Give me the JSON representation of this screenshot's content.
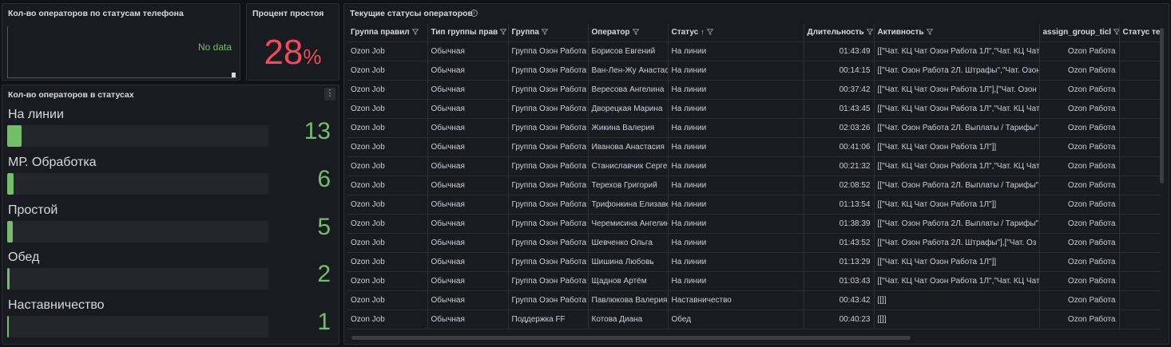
{
  "panel1": {
    "title": "Кол-во операторов по статусам телефона",
    "no_data": "No data"
  },
  "panel2": {
    "title": "Процент простоя",
    "value": "28",
    "unit": "%",
    "color": "#f2495c"
  },
  "panel3": {
    "title": "Кол-во операторов в статусах",
    "max": 13,
    "items": [
      {
        "label": "На линии",
        "value": "13"
      },
      {
        "label": "МР. Обработка",
        "value": "6"
      },
      {
        "label": "Простой",
        "value": "5"
      },
      {
        "label": "Обед",
        "value": "2"
      },
      {
        "label": "Наставничество",
        "value": "1"
      }
    ],
    "color": "#73bf69"
  },
  "panel4": {
    "title": "Текущие статусы операторов",
    "columns": [
      "Группа правил",
      "Тип группы прав",
      "Группа",
      "Оператор",
      "Статус",
      "Длительность",
      "Активность",
      "assign_group_ticl",
      "Статус теле"
    ],
    "rows": [
      [
        "Ozon Job",
        "Обычная",
        "Группа Озон Работа",
        "Борисов Евгений",
        "На линии",
        "01:43:49",
        "[[\"Чат. КЦ Чат Озон Работа 1Л\",\"Чат. КЦ Чат",
        "Ozon Работа",
        ""
      ],
      [
        "Ozon Job",
        "Обычная",
        "Группа Озон Работа",
        "Ван-Лен-Жу Анастасия",
        "На линии",
        "00:14:15",
        "[[\"Чат. Озон Работа 2Л. Штрафы\",\"Чат. Озон",
        "Ozon Работа",
        ""
      ],
      [
        "Ozon Job",
        "Обычная",
        "Группа Озон Работа",
        "Вересова Ангелина",
        "На линии",
        "00:37:42",
        "[[\"Чат. КЦ Чат Озон Работа 1Л\"],[\"Чат. Озон",
        "Ozon Работа",
        ""
      ],
      [
        "Ozon Job",
        "Обычная",
        "Группа Озон Работа",
        "Дворецкая Марина",
        "На линии",
        "01:43:45",
        "[[\"Чат. КЦ Чат Озон Работа 1Л\",\"Чат. КЦ Чат",
        "Ozon Работа",
        ""
      ],
      [
        "Ozon Job",
        "Обычная",
        "Группа Озон Работа",
        "Жикина Валерия",
        "На линии",
        "02:03:26",
        "[[\"Чат. Озон Работа 2Л. Выплаты / Тарифы\"",
        "Ozon Работа",
        ""
      ],
      [
        "Ozon Job",
        "Обычная",
        "Группа Озон Работа",
        "Иванова Анастасия",
        "На линии",
        "00:41:06",
        "[[\"Чат. КЦ Чат Озон Работа 1Л\"]]",
        "Ozon Работа",
        ""
      ],
      [
        "Ozon Job",
        "Обычная",
        "Группа Озон Работа",
        "Станиславчик Сергей",
        "На линии",
        "00:21:32",
        "[[\"Чат. КЦ Чат Озон Работа 1Л\",\"Чат. КЦ Чат",
        "Ozon Работа",
        ""
      ],
      [
        "Ozon Job",
        "Обычная",
        "Группа Озон Работа",
        "Терехов Григорий",
        "На линии",
        "02:08:52",
        "[[\"Чат. Озон Работа 2Л. Выплаты / Тарифы\"",
        "Ozon Работа",
        ""
      ],
      [
        "Ozon Job",
        "Обычная",
        "Группа Озон Работа",
        "Трифонкина Елизавета",
        "На линии",
        "01:13:54",
        "[[\"Чат. КЦ Чат Озон Работа 1Л\"]]",
        "Ozon Работа",
        ""
      ],
      [
        "Ozon Job",
        "Обычная",
        "Группа Озон Работа",
        "Черемисина Ангелина",
        "На линии",
        "01:38:39",
        "[[\"Чат. Озон Работа 2Л. Выплаты / Тарифы\"",
        "Ozon Работа",
        ""
      ],
      [
        "Ozon Job",
        "Обычная",
        "Группа Озон Работа",
        "Шевченко Ольга",
        "На линии",
        "01:43:52",
        "[[\"Чат. Озон Работа 2Л. Штрафы\"],[\"Чат. Оз",
        "Ozon Работа",
        ""
      ],
      [
        "Ozon Job",
        "Обычная",
        "Группа Озон Работа",
        "Шишина Любовь",
        "На линии",
        "01:13:29",
        "[[\"Чат. КЦ Чат Озон Работа 1Л\"]]",
        "Ozon Работа",
        ""
      ],
      [
        "Ozon Job",
        "Обычная",
        "Группа Озон Работа",
        "Щаднов Артём",
        "На линии",
        "01:03:43",
        "[[\"Чат. КЦ Чат Озон Работа 1Л\",\"Чат. КЦ Чат",
        "Ozon Работа",
        ""
      ],
      [
        "Ozon Job",
        "Обычная",
        "Группа Озон Работа",
        "Павлюкова Валерия",
        "Наставничество",
        "00:43:42",
        "[[]]",
        "Ozon Работа",
        ""
      ],
      [
        "Ozon Job",
        "Обычная",
        "Поддержка FF",
        "Котова Диана",
        "Обед",
        "00:40:23",
        "[[]]",
        "Ozon Работа",
        ""
      ]
    ]
  }
}
